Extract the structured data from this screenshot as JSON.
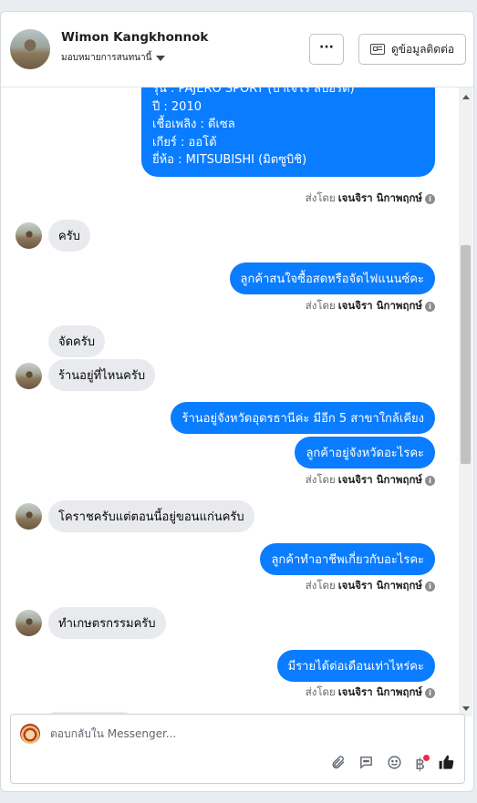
{
  "header": {
    "name": "Wimon Kangkhonnok",
    "assign": "มอบหมายการสนทนานี้",
    "more_label": "···",
    "contact_label": "ดูข้อมูลติดต่อ"
  },
  "top_message": {
    "lines": [
      "รุ่น : PAJERO SPORT (ปาเจโร สปอร์ต)",
      "ปี : 2010",
      "เชื้อเพลิง : ดีเซล",
      "เกียร์ : ออโต้",
      "ยี่ห้อ : MITSUBISHI (มิตซูบิชิ)"
    ]
  },
  "sent_by": {
    "prefix": "ส่งโดย",
    "agent": "เจนจิรา นิกาพฤกษ์",
    "info_icon": "i"
  },
  "messages": {
    "in1": "ครับ",
    "out1": "ลูกค้าสนใจซื้อสดหรือจัดไฟแนนซ์คะ",
    "in2a": "จัดครับ",
    "in2b": "ร้านอยู่ที่ไหนครับ",
    "out2a": "ร้านอยู่จังหวัดอุดรธานีค่ะ มีอีก 5 สาขาใกล้เคียง",
    "out2b": "ลูกค้าอยู่จังหวัดอะไรคะ",
    "in3": "โคราชครับแต่ตอนนี้อยู่ขอนแก่นครับ",
    "out3": "ลูกค้าทำอาชีพเกี่ยวกับอะไรคะ",
    "in4": "ทำเกษตรกรรมครับ",
    "out4": "มีรายได้ต่อเดือนเท่าไหร่คะ"
  },
  "composer": {
    "placeholder": "ตอบกลับใน Messenger...",
    "icons": [
      "paperclip-icon",
      "comment-icon",
      "emoji-icon",
      "baht-icon",
      "like-icon"
    ]
  },
  "colors": {
    "outgoing": "#0a7cff",
    "incoming": "#e9eaed",
    "badge": "#f02849"
  }
}
